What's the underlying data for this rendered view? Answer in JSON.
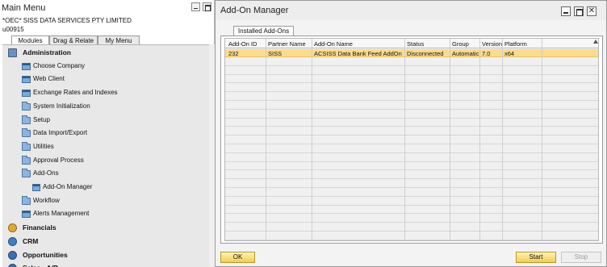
{
  "main_menu": {
    "title": "Main Menu",
    "company": "*OEC* SISS DATA  SERVICES PTY LIMITED",
    "user": "u00915",
    "tabs": [
      {
        "label": "Modules",
        "active": true
      },
      {
        "label": "Drag & Relate",
        "active": false
      },
      {
        "label": "My Menu",
        "active": false
      }
    ],
    "items": [
      {
        "label": "Administration",
        "level": "module",
        "icon": "administration-icon"
      },
      {
        "label": "Choose Company",
        "level": "sub",
        "icon": "window-icon"
      },
      {
        "label": "Web Client",
        "level": "sub",
        "icon": "window-icon"
      },
      {
        "label": "Exchange Rates and Indexes",
        "level": "sub",
        "icon": "window-icon"
      },
      {
        "label": "System Initialization",
        "level": "sub",
        "icon": "folder-icon"
      },
      {
        "label": "Setup",
        "level": "sub",
        "icon": "folder-icon"
      },
      {
        "label": "Data Import/Export",
        "level": "sub",
        "icon": "folder-icon"
      },
      {
        "label": "Utilities",
        "level": "sub",
        "icon": "folder-icon"
      },
      {
        "label": "Approval Process",
        "level": "sub",
        "icon": "folder-icon"
      },
      {
        "label": "Add-Ons",
        "level": "sub",
        "icon": "folder-open-icon"
      },
      {
        "label": "Add-On Manager",
        "level": "subsub",
        "icon": "window-icon"
      },
      {
        "label": "Workflow",
        "level": "sub",
        "icon": "folder-icon"
      },
      {
        "label": "Alerts Management",
        "level": "sub",
        "icon": "window-icon"
      },
      {
        "label": "Financials",
        "level": "module",
        "icon": "financials-icon"
      },
      {
        "label": "CRM",
        "level": "module",
        "icon": "crm-icon"
      },
      {
        "label": "Opportunities",
        "level": "module",
        "icon": "opportunities-icon"
      },
      {
        "label": "Sales - A/R",
        "level": "module",
        "icon": "sales-icon"
      }
    ]
  },
  "addon_manager": {
    "title": "Add-On Manager",
    "tab_label": "Installed Add-Ons",
    "columns": [
      "Add-On ID",
      "Partner Name",
      "Add-On Name",
      "Status",
      "Group",
      "Version",
      "Platform"
    ],
    "rows": [
      {
        "id": "232",
        "partner": "SISS",
        "name": "ACSISS Data Bank Feed AddOn",
        "status": "Disconnected",
        "group": "Automatic",
        "version": "7.0",
        "platform": "x64",
        "selected": true
      }
    ],
    "empty_rows": 22,
    "ok_label": "OK",
    "start_label": "Start",
    "stop_label": "Stop",
    "stop_enabled": false
  },
  "colors": {
    "selected_row": "#fbdb8c",
    "button_gold": "#f1cf52",
    "list_bg": "#e8e8e8"
  }
}
